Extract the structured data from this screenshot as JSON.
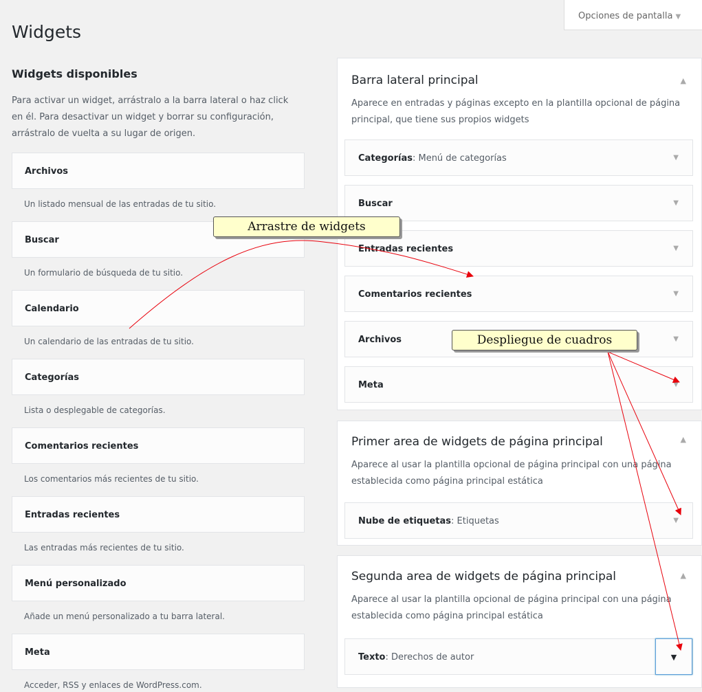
{
  "header": {
    "page_title": "Widgets",
    "screen_options": "Opciones de pantalla"
  },
  "available": {
    "title": "Widgets disponibles",
    "description": "Para activar un widget, arrástralo a la barra lateral o haz click en él. Para desactivar un widget y borrar su configuración, arrástralo de vuelta a su lugar de origen.",
    "widgets": [
      {
        "name": "Archivos",
        "desc": "Un listado mensual de las entradas de tu sitio."
      },
      {
        "name": "Buscar",
        "desc": "Un formulario de búsqueda de tu sitio."
      },
      {
        "name": "Calendario",
        "desc": "Un calendario de las entradas de tu sitio."
      },
      {
        "name": "Categorías",
        "desc": "Lista o desplegable de categorías."
      },
      {
        "name": "Comentarios recientes",
        "desc": "Los comentarios más recientes de tu sitio."
      },
      {
        "name": "Entradas recientes",
        "desc": "Las entradas más recientes de tu sitio."
      },
      {
        "name": "Menú personalizado",
        "desc": "Añade un menú personalizado a tu barra lateral."
      },
      {
        "name": "Meta",
        "desc": "Acceder, RSS y enlaces de WordPress.com."
      }
    ]
  },
  "sidebars": {
    "main": {
      "title": "Barra lateral principal",
      "description": "Aparece en entradas y páginas excepto en la plantilla opcional de página principal, que tiene sus propios widgets",
      "widgets": [
        {
          "name": "Categorías",
          "sub": ": Menú de categorías"
        },
        {
          "name": "Buscar",
          "sub": ""
        },
        {
          "name": "Entradas recientes",
          "sub": ""
        },
        {
          "name": "Comentarios recientes",
          "sub": ""
        },
        {
          "name": "Archivos",
          "sub": ""
        },
        {
          "name": "Meta",
          "sub": ""
        }
      ]
    },
    "front1": {
      "title": "Primer area de widgets de página principal",
      "description": "Aparece al usar la plantilla opcional de página principal con una página establecida como página principal estática",
      "widgets": [
        {
          "name": "Nube de etiquetas",
          "sub": ": Etiquetas"
        }
      ]
    },
    "front2": {
      "title": "Segunda area de widgets de página principal",
      "description": "Aparece al usar la plantilla opcional de página principal con una página establecida como página principal estática",
      "widgets": [
        {
          "name": "Texto",
          "sub": ": Derechos de autor"
        }
      ]
    }
  },
  "annotations": {
    "drag": "Arrastre de widgets",
    "expand": "Despliegue de cuadros"
  },
  "icons": {
    "up": "▲",
    "down": "▼"
  },
  "colors": {
    "annotation_bg": "#ffffcc",
    "arrow": "#e8000b",
    "focus_border": "#5b9dd9"
  }
}
